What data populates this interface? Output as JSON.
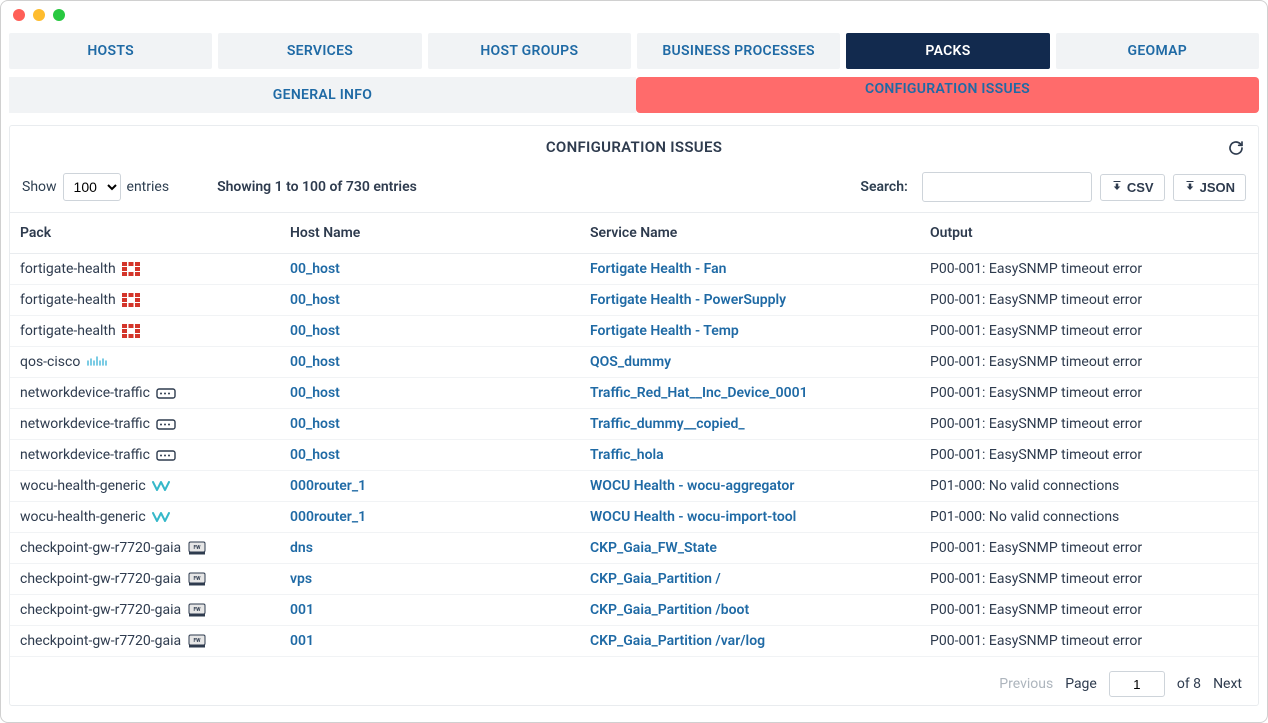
{
  "primary_tabs": {
    "items": [
      "HOSTS",
      "SERVICES",
      "HOST GROUPS",
      "BUSINESS PROCESSES",
      "PACKS",
      "GEOMAP"
    ],
    "active_index": 4
  },
  "sub_tabs": {
    "items": [
      "GENERAL INFO",
      "CONFIGURATION ISSUES"
    ],
    "active_index": 1
  },
  "panel": {
    "title": "CONFIGURATION ISSUES",
    "show_label": "Show",
    "entries_label": "entries",
    "entries_value": "100",
    "info_text": "Showing 1 to 100 of 730 entries",
    "search_label": "Search:",
    "search_value": "",
    "csv_label": "CSV",
    "json_label": "JSON"
  },
  "columns": [
    "Pack",
    "Host Name",
    "Service Name",
    "Output"
  ],
  "rows": [
    {
      "pack": "fortigate-health",
      "icon": "fortinet",
      "host": "00_host",
      "service": "Fortigate Health - Fan",
      "output": "P00-001: EasySNMP timeout error"
    },
    {
      "pack": "fortigate-health",
      "icon": "fortinet",
      "host": "00_host",
      "service": "Fortigate Health - PowerSupply",
      "output": "P00-001: EasySNMP timeout error"
    },
    {
      "pack": "fortigate-health",
      "icon": "fortinet",
      "host": "00_host",
      "service": "Fortigate Health - Temp",
      "output": "P00-001: EasySNMP timeout error"
    },
    {
      "pack": "qos-cisco",
      "icon": "cisco",
      "host": "00_host",
      "service": "QOS_dummy",
      "output": "P00-001: EasySNMP timeout error"
    },
    {
      "pack": "networkdevice-traffic",
      "icon": "device",
      "host": "00_host",
      "service": "Traffic_Red_Hat__Inc_Device_0001",
      "output": "P00-001: EasySNMP timeout error"
    },
    {
      "pack": "networkdevice-traffic",
      "icon": "device",
      "host": "00_host",
      "service": "Traffic_dummy__copied_",
      "output": "P00-001: EasySNMP timeout error"
    },
    {
      "pack": "networkdevice-traffic",
      "icon": "device",
      "host": "00_host",
      "service": "Traffic_hola",
      "output": "P00-001: EasySNMP timeout error"
    },
    {
      "pack": "wocu-health-generic",
      "icon": "wocu",
      "host": "000router_1",
      "service": "WOCU Health - wocu-aggregator",
      "output": "P01-000: No valid connections"
    },
    {
      "pack": "wocu-health-generic",
      "icon": "wocu",
      "host": "000router_1",
      "service": "WOCU Health - wocu-import-tool",
      "output": "P01-000: No valid connections"
    },
    {
      "pack": "checkpoint-gw-r7720-gaia",
      "icon": "checkpoint",
      "host": "dns",
      "service": "CKP_Gaia_FW_State",
      "output": "P00-001: EasySNMP timeout error"
    },
    {
      "pack": "checkpoint-gw-r7720-gaia",
      "icon": "checkpoint",
      "host": "vps",
      "service": "CKP_Gaia_Partition /",
      "output": "P00-001: EasySNMP timeout error"
    },
    {
      "pack": "checkpoint-gw-r7720-gaia",
      "icon": "checkpoint",
      "host": "001",
      "service": "CKP_Gaia_Partition /boot",
      "output": "P00-001: EasySNMP timeout error"
    },
    {
      "pack": "checkpoint-gw-r7720-gaia",
      "icon": "checkpoint",
      "host": "001",
      "service": "CKP_Gaia_Partition /var/log",
      "output": "P00-001: EasySNMP timeout error"
    }
  ],
  "pagination": {
    "previous": "Previous",
    "next": "Next",
    "page_label": "Page",
    "of_label": "of 8",
    "current": "1"
  }
}
